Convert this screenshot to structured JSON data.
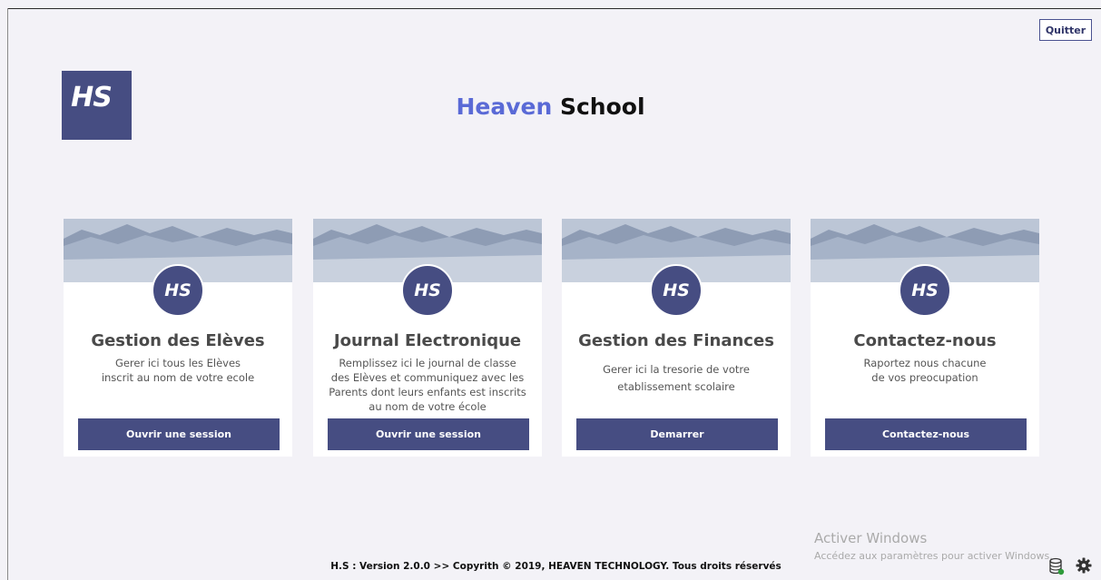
{
  "header": {
    "quit_label": "Quitter",
    "logo_text": "HS",
    "title_part1": "Heaven",
    "title_part2": "School"
  },
  "cards": [
    {
      "badge": "HS",
      "title": "Gestion des Elèves",
      "desc_lines": [
        "Gerer ici tous les Elèves",
        "inscrit au nom de votre ecole"
      ],
      "button": "Ouvrir une session"
    },
    {
      "badge": "HS",
      "title": "Journal Electronique",
      "desc_lines": [
        "Remplissez ici le journal de classe",
        "des Elèves et communiquez avec les",
        "Parents dont leurs enfants est inscrits",
        "au nom de votre école"
      ],
      "button": "Ouvrir une session"
    },
    {
      "badge": "HS",
      "title": "Gestion des Finances",
      "desc_lines": [
        "Gerer ici la tresorie de votre",
        "etablissement scolaire"
      ],
      "button": "Demarrer"
    },
    {
      "badge": "HS",
      "title": "Contactez-nous",
      "desc_lines": [
        "Raportez nous chacune",
        "de vos preocupation"
      ],
      "button": "Contactez-nous"
    }
  ],
  "footer": {
    "text": "H.S : Version 2.0.0 >> Copyrith © 2019, HEAVEN TECHNOLOGY. Tous droits réservés"
  },
  "watermark": {
    "line1": "Activer Windows",
    "line2": "Accédez aux paramètres pour activer Windows."
  },
  "icons": {
    "database": "database-icon",
    "settings": "gear-icon"
  },
  "colors": {
    "accent": "#464d82",
    "title_blue": "#5a6ad6",
    "background": "#f3f2f7"
  }
}
